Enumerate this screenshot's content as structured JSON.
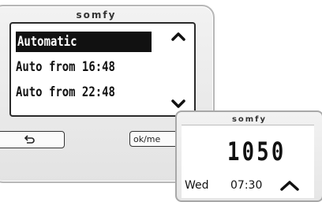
{
  "main_device": {
    "brand": "somfy",
    "menu": {
      "items": [
        {
          "label": "Automatic",
          "selected": true
        },
        {
          "label": "Auto from 16:48",
          "selected": false
        },
        {
          "label": "Auto from 22:48",
          "selected": false
        }
      ]
    },
    "buttons": {
      "back_icon": "return-arrow-icon",
      "ok_label": "ok/me"
    }
  },
  "small_device": {
    "brand": "somfy",
    "segment_display": "1050",
    "day": "Wed",
    "time": "07:30",
    "arrow_icon": "chevron-up-icon"
  }
}
